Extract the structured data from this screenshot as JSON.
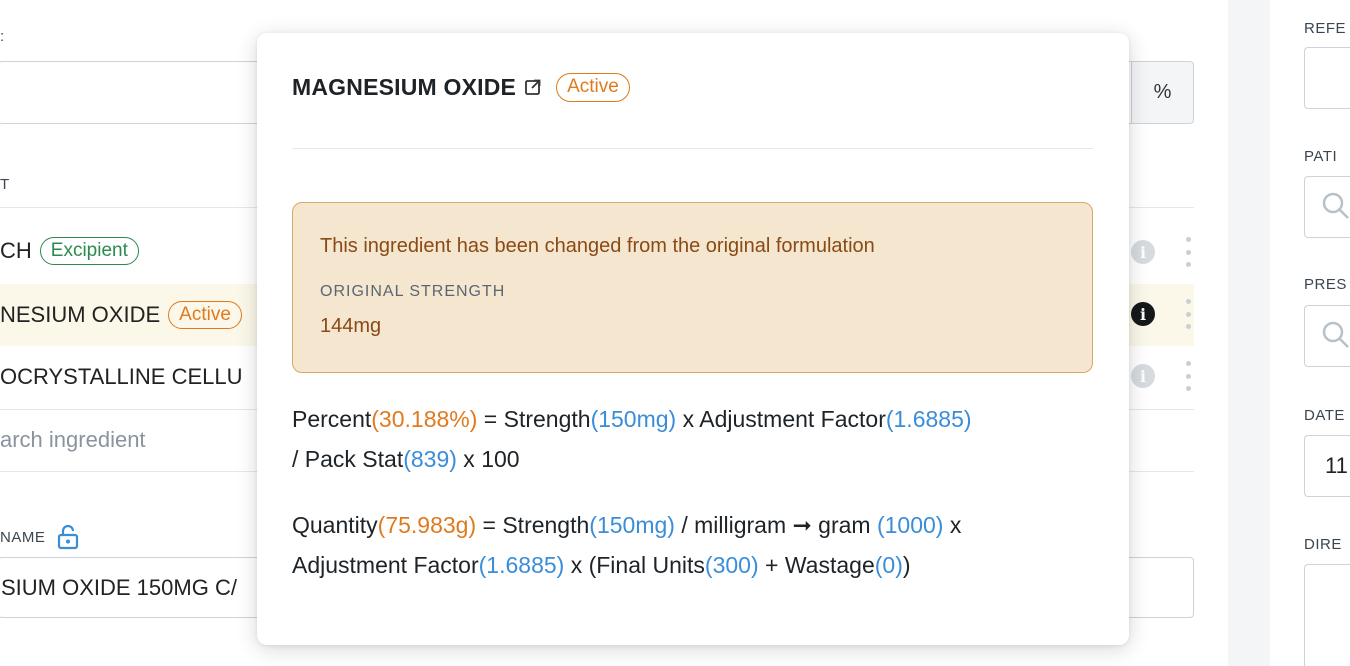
{
  "form": {
    "percent_symbol": "%",
    "column_header_fragment": "T",
    "ingredients": [
      {
        "name": "CH",
        "badge": "Excipient"
      },
      {
        "name": "NESIUM OXIDE",
        "badge": "Active"
      },
      {
        "name": "OCRYSTALLINE CELLU",
        "badge": ""
      }
    ],
    "search_placeholder": "arch ingredient",
    "name_label": "NAME",
    "name_value": "SIUM OXIDE 150MG C/"
  },
  "sidebar": {
    "labels": [
      "REFE",
      "PATI",
      "PRES",
      "DATE",
      "DIRE"
    ],
    "date_value": "11"
  },
  "popover": {
    "title": "MAGNESIUM OXIDE",
    "status_badge": "Active",
    "alert": {
      "message": "This ingredient has been changed from the original formulation",
      "label": "ORIGINAL STRENGTH",
      "value": "144mg"
    },
    "percent_formula": {
      "label": "Percent",
      "result": "(30.188%)",
      "eq": " = Strength",
      "strength": "(150mg)",
      "x_adj": " x Adjustment Factor",
      "adj_factor": "(1.6885)",
      "line2_prefix": "/ Pack Stat",
      "pack_stat": "(839)",
      "line2_suffix": " x 100"
    },
    "quantity_formula": {
      "label": "Quantity",
      "result": "(75.983g)",
      "eq": " = Strength",
      "strength": "(150mg)",
      "conv": " / milligram ➞ gram ",
      "conv_val": "(1000)",
      "x": " x",
      "line2_prefix": "Adjustment Factor",
      "adj_factor": "(1.6885)",
      "final_units_label": " x (Final Units",
      "final_units": "(300)",
      "wastage_label": " + Wastage",
      "wastage_open": "(",
      "wastage": "0",
      "wastage_close": ")",
      "end": ")"
    }
  },
  "colors": {
    "active": "#e07a1f",
    "excipient": "#2c8a4e",
    "value_blue": "#3a8dd8",
    "alert_bg": "#f5e6cf"
  }
}
